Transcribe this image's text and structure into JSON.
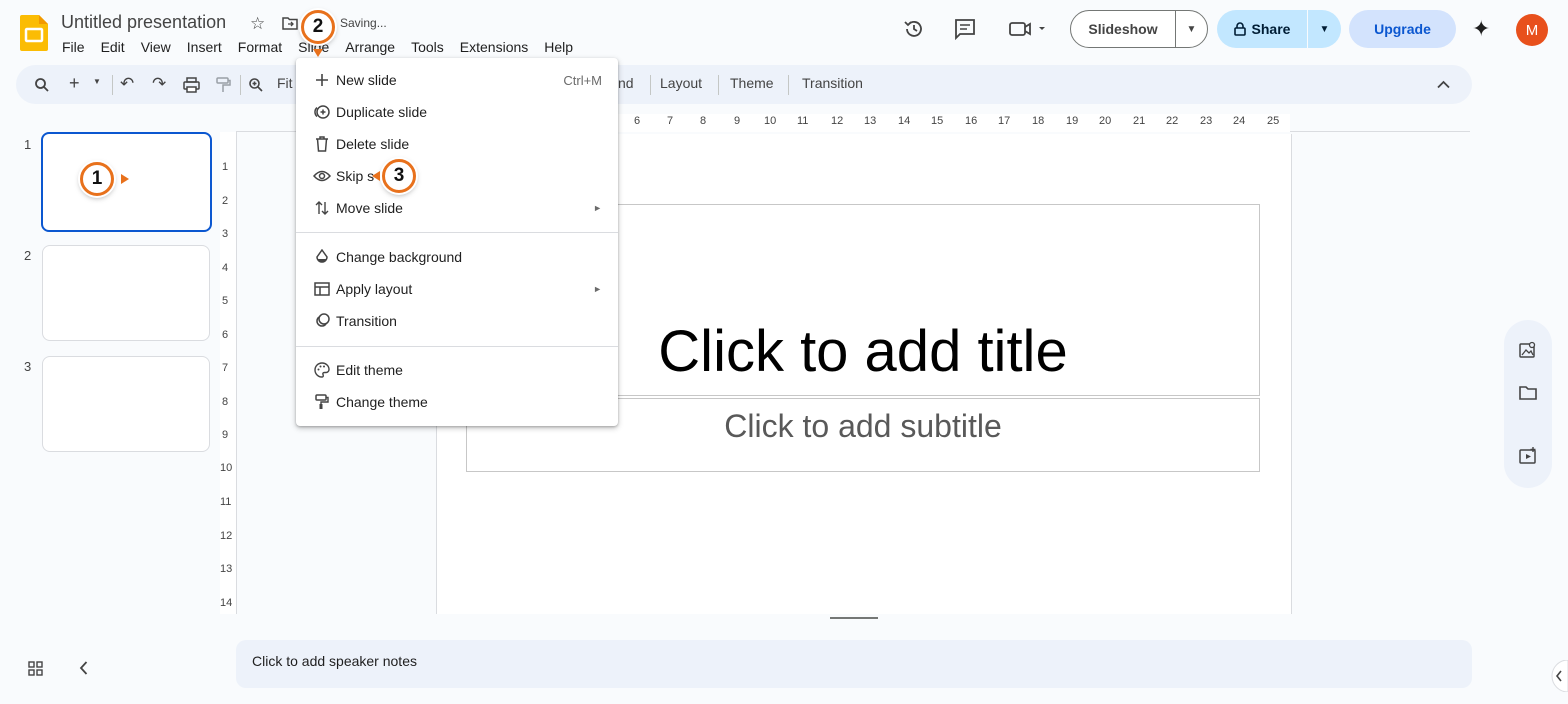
{
  "header": {
    "doc_title": "Untitled presentation",
    "status": "Saving...",
    "menus": [
      "File",
      "Edit",
      "View",
      "Insert",
      "Format",
      "Slide",
      "Arrange",
      "Tools",
      "Extensions",
      "Help"
    ],
    "slideshow_label": "Slideshow",
    "share_label": "Share",
    "upgrade_label": "Upgrade",
    "avatar_initial": "M"
  },
  "toolbar": {
    "zoom_label": "Fit",
    "background_label": "nd",
    "layout_label": "Layout",
    "theme_label": "Theme",
    "transition_label": "Transition"
  },
  "slide_menu": {
    "items": [
      {
        "label": "New slide",
        "shortcut": "Ctrl+M",
        "icon": "plus-icon"
      },
      {
        "label": "Duplicate slide",
        "icon": "duplicate-icon"
      },
      {
        "label": "Delete slide",
        "icon": "trash-icon"
      },
      {
        "label": "Skip s",
        "icon": "eye-icon"
      },
      {
        "label": "Move slide",
        "icon": "move-icon",
        "submenu": true
      },
      {
        "label": "Change background",
        "icon": "droplet-icon"
      },
      {
        "label": "Apply layout",
        "icon": "layout-icon",
        "submenu": true
      },
      {
        "label": "Transition",
        "icon": "transition-icon"
      },
      {
        "label": "Edit theme",
        "icon": "palette-icon"
      },
      {
        "label": "Change theme",
        "icon": "paint-roller-icon"
      }
    ]
  },
  "filmstrip": {
    "slide_numbers": [
      "1",
      "2",
      "3"
    ]
  },
  "rulers": {
    "horizontal": [
      "6",
      "7",
      "8",
      "9",
      "10",
      "11",
      "12",
      "13",
      "14",
      "15",
      "16",
      "17",
      "18",
      "19",
      "20",
      "21",
      "22",
      "23",
      "24",
      "25"
    ],
    "vertical": [
      "1",
      "2",
      "3",
      "4",
      "5",
      "6",
      "7",
      "8",
      "9",
      "10",
      "11",
      "12",
      "13",
      "14"
    ]
  },
  "slide": {
    "title_placeholder": "Click to add title",
    "subtitle_placeholder": "Click to add subtitle"
  },
  "notes": {
    "placeholder": "Click to add speaker notes"
  },
  "callouts": [
    "1",
    "2",
    "3"
  ],
  "colors": {
    "accent": "#0b57d0",
    "callout_ring": "#e8711c",
    "logo": "#fbbc04",
    "avatar": "#e8501c"
  }
}
